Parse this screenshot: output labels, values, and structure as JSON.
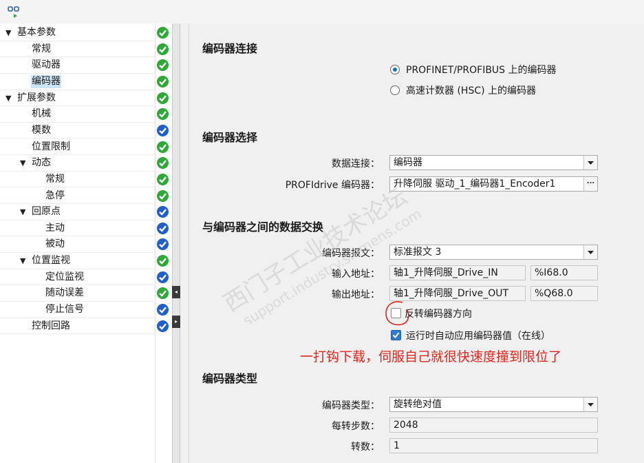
{
  "nav": {
    "items": [
      {
        "label": "基本参数",
        "level": 0,
        "expandable": true,
        "status": "green"
      },
      {
        "label": "常规",
        "level": 1,
        "expandable": false,
        "status": "green"
      },
      {
        "label": "驱动器",
        "level": 1,
        "expandable": false,
        "status": "green"
      },
      {
        "label": "编码器",
        "level": 1,
        "expandable": false,
        "status": "green",
        "selected": true
      },
      {
        "label": "扩展参数",
        "level": 0,
        "expandable": true,
        "status": "green"
      },
      {
        "label": "机械",
        "level": 1,
        "expandable": false,
        "status": "green"
      },
      {
        "label": "模数",
        "level": 1,
        "expandable": false,
        "status": "blue"
      },
      {
        "label": "位置限制",
        "level": 1,
        "expandable": false,
        "status": "green"
      },
      {
        "label": "动态",
        "level": 1,
        "expandable": true,
        "status": "green"
      },
      {
        "label": "常规",
        "level": 2,
        "expandable": false,
        "status": "green"
      },
      {
        "label": "急停",
        "level": 2,
        "expandable": false,
        "status": "green"
      },
      {
        "label": "回原点",
        "level": 1,
        "expandable": true,
        "status": "blue"
      },
      {
        "label": "主动",
        "level": 2,
        "expandable": false,
        "status": "blue"
      },
      {
        "label": "被动",
        "level": 2,
        "expandable": false,
        "status": "blue"
      },
      {
        "label": "位置监视",
        "level": 1,
        "expandable": true,
        "status": "green"
      },
      {
        "label": "定位监视",
        "level": 2,
        "expandable": false,
        "status": "blue"
      },
      {
        "label": "随动误差",
        "level": 2,
        "expandable": false,
        "status": "green"
      },
      {
        "label": "停止信号",
        "level": 2,
        "expandable": false,
        "status": "blue"
      },
      {
        "label": "控制回路",
        "level": 1,
        "expandable": false,
        "status": "blue"
      }
    ]
  },
  "colors": {
    "status_green": "#2ea836",
    "status_blue": "#1f5fc9",
    "annotation_red": "#e5241c",
    "check_blue": "#2c7bd0"
  },
  "encoder_connection": {
    "title": "编码器连接",
    "option1": "PROFINET/PROFIBUS 上的编码器",
    "option1_selected": true,
    "option2": "高速计数器 (HSC) 上的编码器",
    "option2_selected": false
  },
  "encoder_selection": {
    "title": "编码器选择",
    "data_connection_label": "数据连接：",
    "data_connection_value": "编码器",
    "profidrive_label": "PROFIdrive 编码器：",
    "profidrive_value": "升降伺服 驱动_1_编码器1_Encoder1",
    "browse_button": "..."
  },
  "data_exchange": {
    "title": "与编码器之间的数据交换",
    "telegram_label": "编码器报文：",
    "telegram_value": "标准报文 3",
    "input_label": "输入地址：",
    "input_name": "轴1_升降伺服_Drive_IN",
    "input_addr": "%I68.0",
    "output_label": "输出地址：",
    "output_name": "轴1_升降伺服_Drive_OUT",
    "output_addr": "%Q68.0",
    "invert_label": "反转编码器方向",
    "invert_checked": false,
    "auto_apply_label": "运行时自动应用编码器值（在线）",
    "auto_apply_checked": true
  },
  "annotation": "一打钩下载，伺服自己就很快速度撞到限位了",
  "encoder_type": {
    "title": "编码器类型",
    "type_label": "编码器类型：",
    "type_value": "旋转绝对值",
    "steps_label": "每转步数：",
    "steps_value": "2048",
    "revs_label": "转数：",
    "revs_value": "1"
  },
  "watermark": {
    "line1": "西门子工业技术论坛",
    "line2": "support.industry.siemens.com"
  }
}
